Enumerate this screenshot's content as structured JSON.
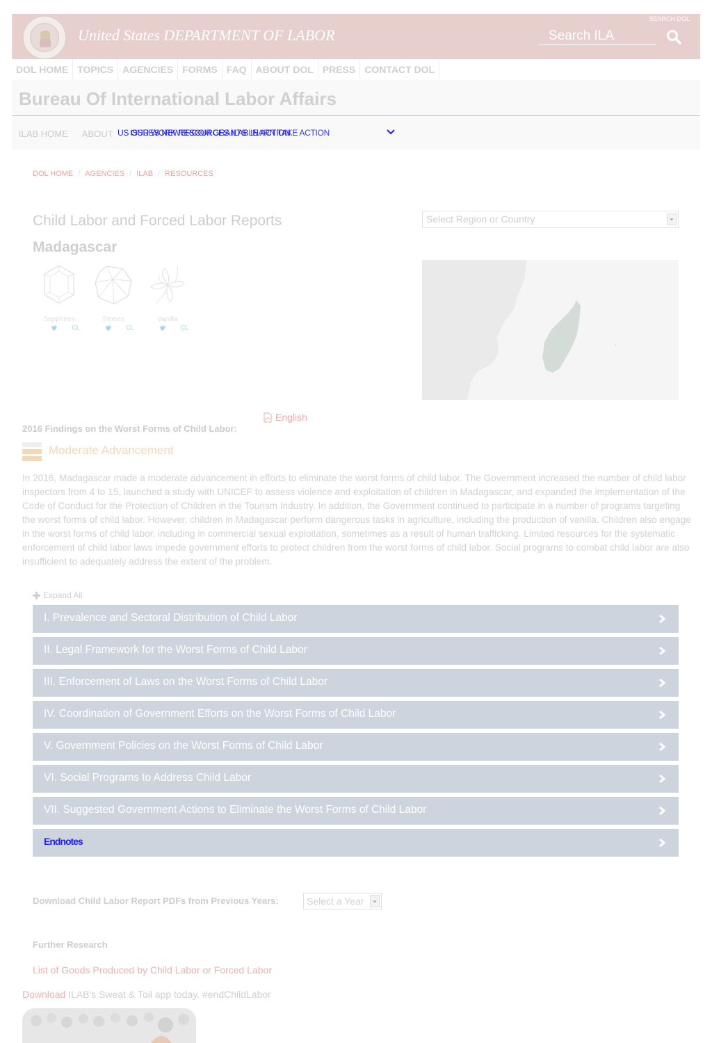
{
  "header": {
    "title": "United States DEPARTMENT OF LABOR",
    "search_label": "SEARCH DOL",
    "search_placeholder": "Search ILA"
  },
  "top_nav": [
    "DOL HOME",
    "TOPICS",
    "AGENCIES",
    "FORMS",
    "FAQ",
    "ABOUT DOL",
    "PRESS",
    "CONTACT DOL"
  ],
  "bureau": {
    "title": "Bureau Of International Labor Affairs",
    "subnav_home": "ILAB HOME",
    "subnav_about": "ABOUT",
    "subnav_overlap_a": "US  OUR WORK  RESOURCES  ILAB IN ACTION",
    "subnav_overlap_b": "ISSUES  NEWSROOM  GRANTS  LEARN  TAKE ACTION"
  },
  "breadcrumb": [
    "DOL HOME",
    "AGENCIES",
    "ILAB",
    "RESOURCES"
  ],
  "report": {
    "title": "Child Labor and Forced Labor Reports",
    "country": "Madagascar",
    "region_select": "Select Region or Country"
  },
  "goods": [
    {
      "name": "Sapphires",
      "badge": "CL",
      "icon": "sapphire-icon"
    },
    {
      "name": "Stones",
      "badge": "CL",
      "icon": "stones-icon"
    },
    {
      "name": "Vanilla",
      "badge": "CL",
      "icon": "vanilla-icon"
    }
  ],
  "findings": {
    "pdf_label": "English",
    "label": "2016 Findings on the Worst Forms of Child Labor:",
    "assessment": "Moderate Advancement",
    "summary": "In 2016, Madagascar made a moderate advancement in efforts to eliminate the worst forms of child labor. The Government increased the number of child labor inspectors from 4 to 15, launched a study with UNICEF to assess violence and exploitation of children in Madagascar, and expanded the implementation of the Code of Conduct for the Protection of Children in the Tourism Industry. In addition, the Government continued to participate in a number of programs targeting the worst forms of child labor. However, children in Madagascar perform dangerous tasks in agriculture, including the production of vanilla. Children also engage in the worst forms of child labor, including in commercial sexual exploitation, sometimes as a result of human trafficking. Limited resources for the systematic enforcement of child labor laws impede government efforts to protect children from the worst forms of child labor. Social programs to combat child labor are also insufficient to adequately address the extent of the problem."
  },
  "accordion": {
    "expand_all": "Expand All",
    "sections": [
      "I. Prevalence and Sectoral Distribution of Child Labor",
      "II. Legal Framework for the Worst Forms of Child Labor",
      "III. Enforcement of Laws on the Worst Forms of Child Labor",
      "IV. Coordination of Government Efforts on the Worst Forms of Child Labor",
      "V. Government Policies on the Worst Forms of Child Labor",
      "VI. Social Programs to Address Child Labor",
      "VII. Suggested Government Actions to Eliminate the Worst Forms of Child Labor",
      "Endnotes"
    ]
  },
  "download": {
    "label": "Download Child Labor Report PDFs from Previous Years:",
    "year_select": "Select a Year"
  },
  "further": {
    "label": "Further Research",
    "goods_link_a": "List of Goods Produced by Child Labor",
    "goods_link_or": " or ",
    "goods_link_b": "Forced Labor"
  },
  "app": {
    "link": "Download",
    "text": " ILAB's Sweat & Toil app today. #endChildLabor"
  },
  "colors": {
    "header_bg": "#e6cfcc",
    "accordion_bg": "#cdd4de",
    "link": "#eeb1ad",
    "assessment": "#f2d8b8"
  }
}
